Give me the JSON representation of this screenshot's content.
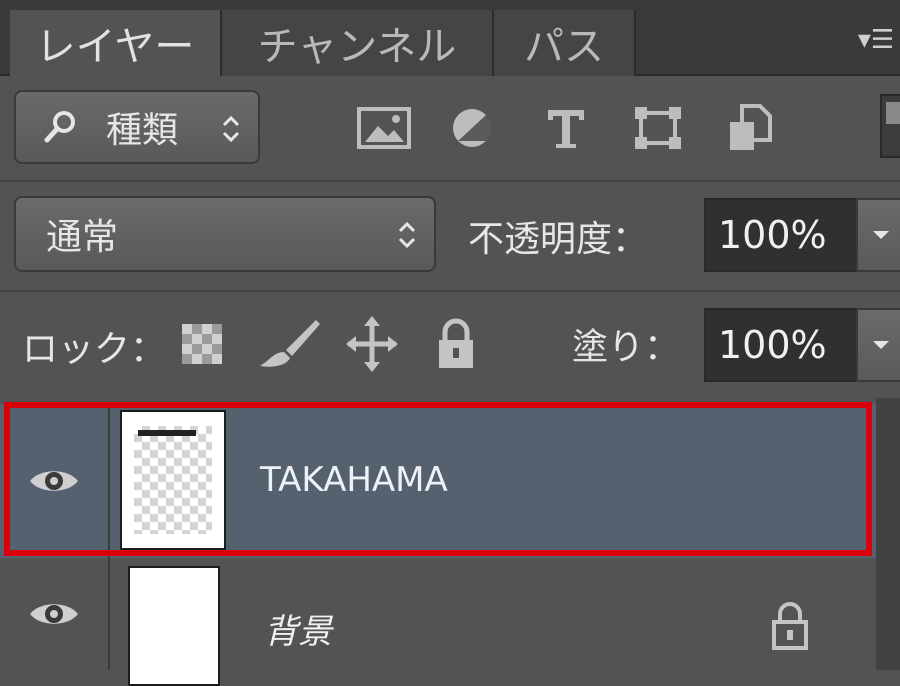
{
  "tabs": [
    {
      "label": "レイヤー",
      "active": true
    },
    {
      "label": "チャンネル",
      "active": false
    },
    {
      "label": "パス",
      "active": false
    }
  ],
  "panel_menu_icon": "panel-menu-icon",
  "filter": {
    "icon": "search-icon",
    "label": "種類",
    "kind_icons": [
      "image-filter-icon",
      "adjustment-filter-icon",
      "type-filter-icon",
      "shape-filter-icon",
      "smart-object-filter-icon"
    ]
  },
  "blend": {
    "mode": "通常",
    "opacity_label": "不透明度：",
    "opacity_value": "100%"
  },
  "lock": {
    "label": "ロック：",
    "icons": [
      "lock-transparent-icon",
      "lock-image-icon",
      "lock-position-icon",
      "lock-all-icon"
    ],
    "fill_label": "塗り：",
    "fill_value": "100%"
  },
  "layers": [
    {
      "name": "TAKAHAMA",
      "selected": true,
      "visible": true
    },
    {
      "name": "背景",
      "selected": false,
      "visible": true,
      "locked": true
    }
  ],
  "colors": {
    "panel_bg": "#535353",
    "selected_row": "#55616f",
    "highlight_frame": "#d9000b"
  }
}
